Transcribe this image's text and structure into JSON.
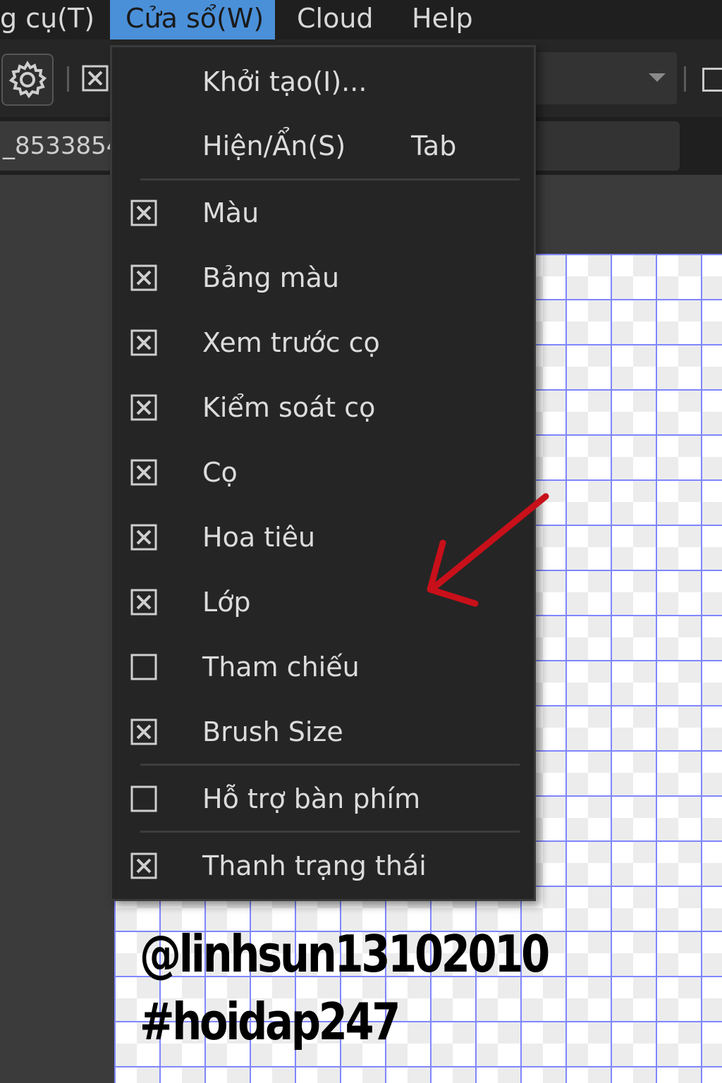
{
  "menubar": {
    "items": [
      {
        "label": "g cụ(T)",
        "active": false
      },
      {
        "label": "Cửa sổ(W)",
        "active": true
      },
      {
        "label": "Cloud",
        "active": false
      },
      {
        "label": "Help",
        "active": false
      }
    ]
  },
  "toolbar": {
    "settings_icon": "gear-icon"
  },
  "tabs": {
    "document_tab": "_8533854"
  },
  "window_menu": {
    "items": [
      {
        "label": "Khởi tạo(I)...",
        "checkbox": "none"
      },
      {
        "label": "Hiện/Ẩn(S)",
        "shortcut": "Tab",
        "checkbox": "none"
      },
      {
        "label": "Màu",
        "checkbox": "checked"
      },
      {
        "label": "Bảng màu",
        "checkbox": "checked"
      },
      {
        "label": "Xem trước cọ",
        "checkbox": "checked"
      },
      {
        "label": "Kiểm soát cọ",
        "checkbox": "checked"
      },
      {
        "label": "Cọ",
        "checkbox": "checked"
      },
      {
        "label": "Hoa tiêu",
        "checkbox": "checked"
      },
      {
        "label": "Lớp",
        "checkbox": "checked"
      },
      {
        "label": "Tham chiếu",
        "checkbox": "unchecked"
      },
      {
        "label": "Brush Size",
        "checkbox": "checked"
      },
      {
        "label": "Hỗ trợ bàn phím",
        "checkbox": "unchecked"
      },
      {
        "label": "Thanh trạng thái",
        "checkbox": "checked"
      }
    ]
  },
  "watermark": {
    "handle": "@linhsun13102010",
    "hashtag": "#hoidap247"
  },
  "colors": {
    "menu_highlight": "#4a90d9",
    "annotation_arrow": "#c8101a",
    "grid_line": "#7f86ff"
  }
}
